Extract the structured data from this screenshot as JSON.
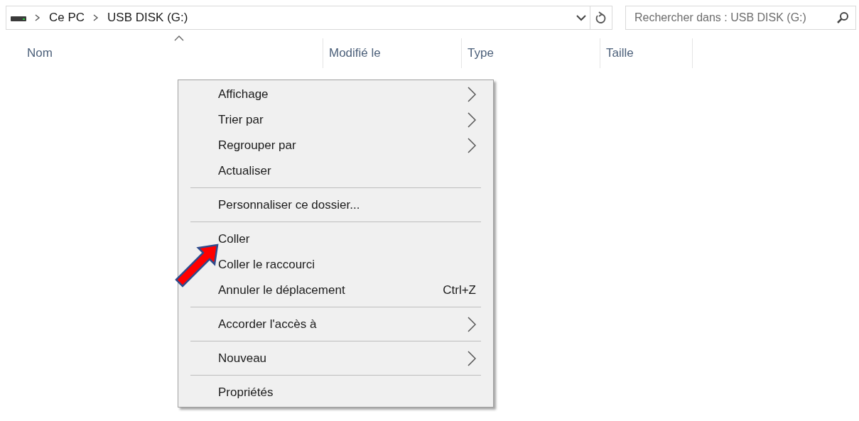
{
  "address_bar": {
    "breadcrumbs": [
      {
        "label": "Ce PC"
      },
      {
        "label": "USB DISK (G:)"
      }
    ]
  },
  "search": {
    "placeholder": "Rechercher dans : USB DISK (G:)"
  },
  "columns": [
    {
      "label": "Nom",
      "sorted": true
    },
    {
      "label": "Modifié le",
      "sorted": false
    },
    {
      "label": "Type",
      "sorted": false
    },
    {
      "label": "Taille",
      "sorted": false
    }
  ],
  "context_menu": {
    "items": [
      {
        "kind": "item",
        "label": "Affichage",
        "submenu": true
      },
      {
        "kind": "item",
        "label": "Trier par",
        "submenu": true
      },
      {
        "kind": "item",
        "label": "Regrouper par",
        "submenu": true
      },
      {
        "kind": "item",
        "label": "Actualiser",
        "submenu": false
      },
      {
        "kind": "separator"
      },
      {
        "kind": "item",
        "label": "Personnaliser ce dossier...",
        "submenu": false
      },
      {
        "kind": "separator"
      },
      {
        "kind": "item",
        "label": "Coller",
        "submenu": false
      },
      {
        "kind": "item",
        "label": "Coller le raccourci",
        "submenu": false
      },
      {
        "kind": "item",
        "label": "Annuler le déplacement",
        "shortcut": "Ctrl+Z",
        "submenu": false
      },
      {
        "kind": "separator"
      },
      {
        "kind": "item",
        "label": "Accorder l'accès à",
        "submenu": true
      },
      {
        "kind": "separator"
      },
      {
        "kind": "item",
        "label": "Nouveau",
        "submenu": true
      },
      {
        "kind": "separator"
      },
      {
        "kind": "item",
        "label": "Propriétés",
        "submenu": false
      }
    ]
  }
}
